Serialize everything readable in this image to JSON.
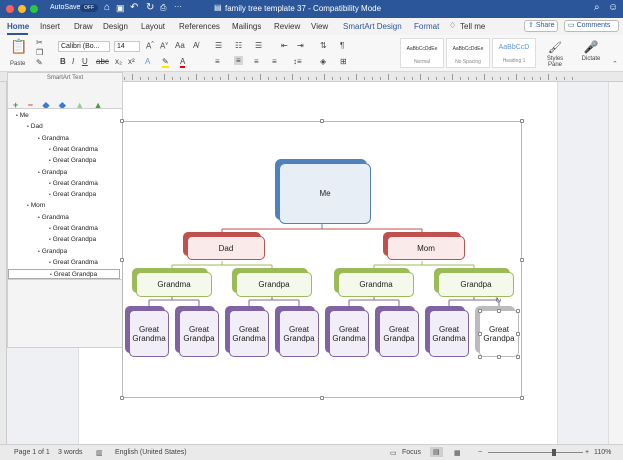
{
  "window": {
    "autosave_label": "AutoSave",
    "autosave_state": "OFF",
    "title": "family tree template 37  -  Compatibility Mode"
  },
  "tabs": [
    "Home",
    "Insert",
    "Draw",
    "Design",
    "Layout",
    "References",
    "Mailings",
    "Review",
    "View",
    "SmartArt Design",
    "Format"
  ],
  "tell_me": "Tell me",
  "share": "Share",
  "comments": "Comments",
  "ribbon": {
    "paste": "Paste",
    "font_name": "Calibri (Bo...",
    "font_size": "14",
    "styles": [
      {
        "sample": "AaBbCcDdEe",
        "name": "Normal"
      },
      {
        "sample": "AaBbCcDdEe",
        "name": "No Spacing"
      },
      {
        "sample": "AaBbCcD",
        "name": "Heading 1"
      }
    ],
    "styles_pane": "Styles Pane",
    "dictate": "Dictate"
  },
  "smartart_text_panel": {
    "title": "SmartArt Text",
    "toolbar": [
      "+",
      "−",
      "◆",
      "◆",
      "▲",
      "▲"
    ],
    "items": [
      {
        "text": "Me",
        "level": 0
      },
      {
        "text": "Dad",
        "level": 1
      },
      {
        "text": "Grandma",
        "level": 2
      },
      {
        "text": "Great Grandma",
        "level": 3
      },
      {
        "text": "Great Grandpa",
        "level": 3
      },
      {
        "text": "Grandpa",
        "level": 2
      },
      {
        "text": "Great Grandma",
        "level": 3
      },
      {
        "text": "Great Grandpa",
        "level": 3
      },
      {
        "text": "Mom",
        "level": 1
      },
      {
        "text": "Grandma",
        "level": 2
      },
      {
        "text": "Great Grandma",
        "level": 3
      },
      {
        "text": "Great Grandpa",
        "level": 3
      },
      {
        "text": "Grandpa",
        "level": 2
      },
      {
        "text": "Great Grandma",
        "level": 3
      },
      {
        "text": "Great Grandpa",
        "level": 3
      }
    ]
  },
  "diagram": {
    "root": "Me",
    "parents": [
      "Dad",
      "Mom"
    ],
    "grandparents": [
      "Grandma",
      "Grandpa",
      "Grandma",
      "Grandpa"
    ],
    "great_grandparents": [
      "Great Grandma",
      "Great Grandpa",
      "Great Grandma",
      "Great Grandpa",
      "Great Grandma",
      "Great Grandpa",
      "Great Grandma",
      "Great Grandpa"
    ],
    "colors": {
      "root": "#4f81bd",
      "parents": "#c0504d",
      "grandparents": "#9bbb59",
      "great_grandparents": "#8064a2"
    }
  },
  "statusbar": {
    "page": "Page 1 of 1",
    "words": "3 words",
    "language": "English (United States)",
    "focus": "Focus",
    "zoom": "110%"
  }
}
